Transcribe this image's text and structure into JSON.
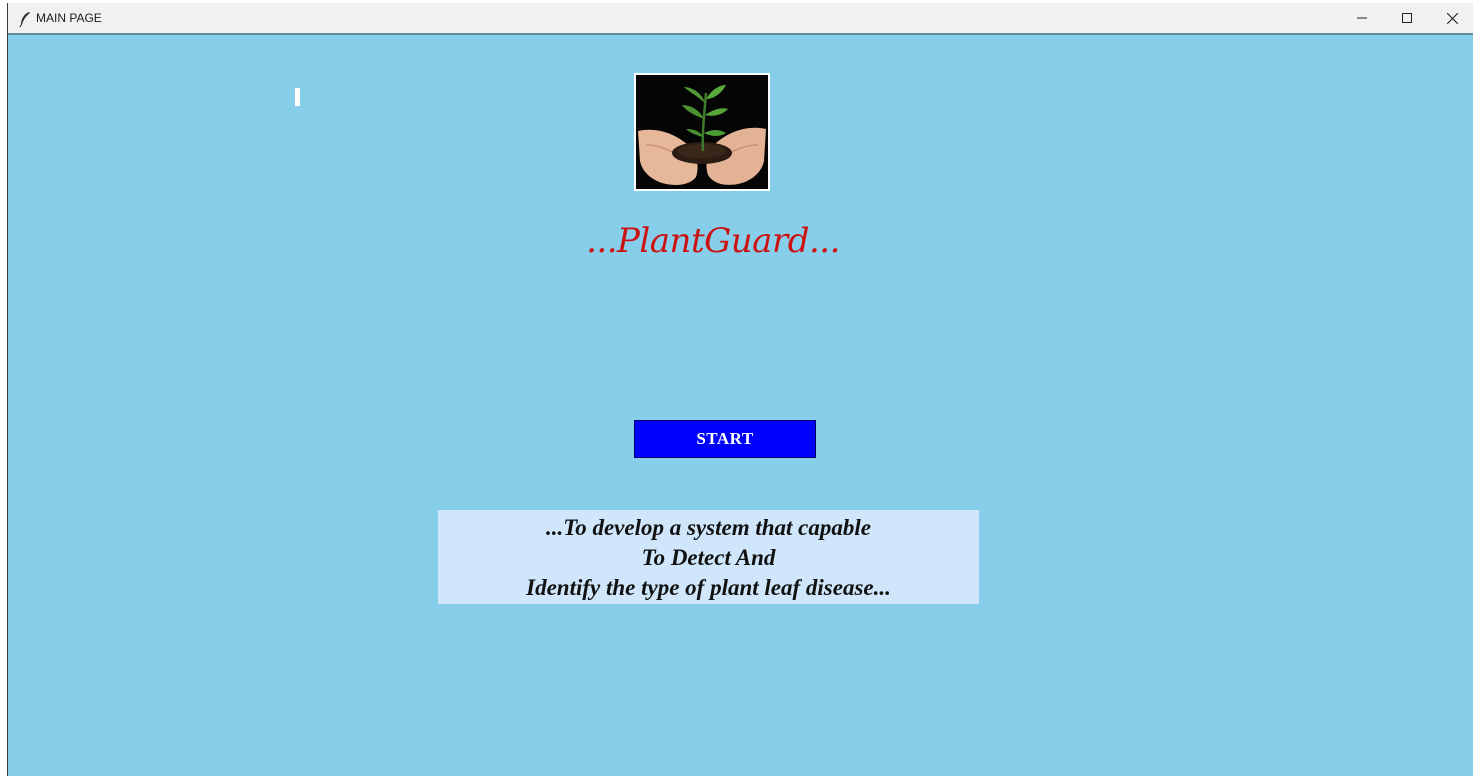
{
  "window": {
    "title": "MAIN PAGE",
    "app_icon": "feather-icon",
    "controls": {
      "minimize_icon": "minimize-icon",
      "maximize_icon": "maximize-icon",
      "close_icon": "close-icon"
    }
  },
  "main": {
    "logo_image": "seedling-in-hands-image",
    "title": "...PlantGuard...",
    "start_button": "START",
    "description": [
      "...To develop a system that capable",
      "To Detect And",
      "Identify the type of plant leaf disease..."
    ]
  },
  "colors": {
    "background": "#87ceeb",
    "title_color": "#cc1111",
    "button_color": "#0000ff",
    "description_bg": "#cfe6fb"
  }
}
